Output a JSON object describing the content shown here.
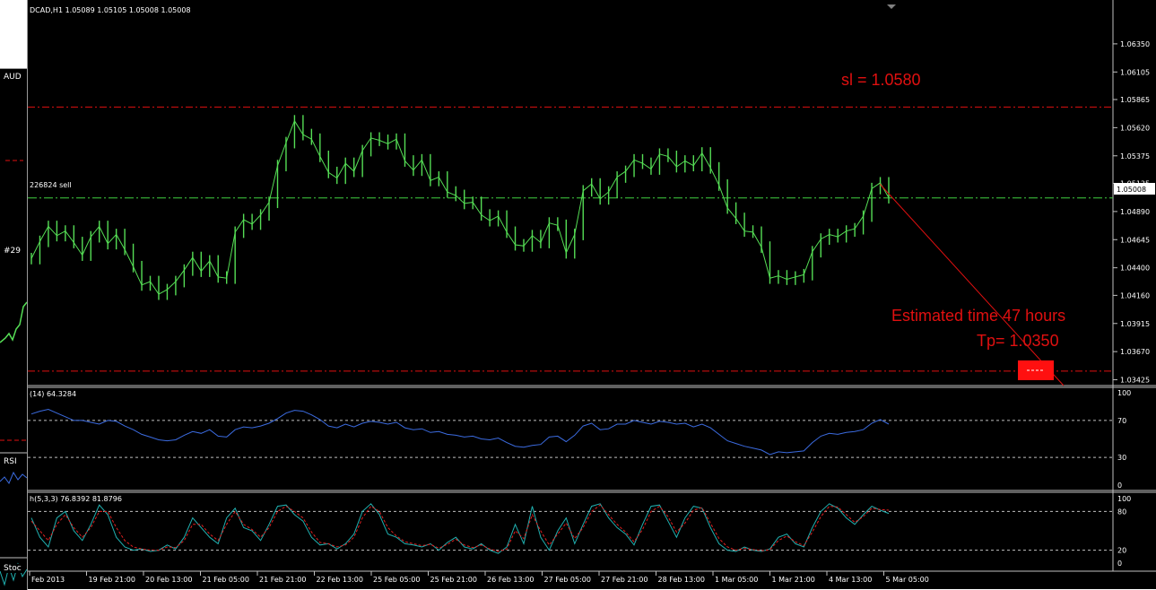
{
  "background_window": {
    "labels": [
      "AUD",
      "#29",
      "RSI",
      "Stoc"
    ]
  },
  "chart_data": {
    "type": "line",
    "symbol_header": "DCAD,H1  1.05089 1.05105 1.05008 1.05008",
    "price_axis_labels": [
      "1.06350",
      "1.06105",
      "1.05865",
      "1.05620",
      "1.05375",
      "1.05135",
      "1.04890",
      "1.04645",
      "1.04400",
      "1.04160",
      "1.03915",
      "1.03670",
      "1.03425"
    ],
    "current_price_label": "1.05008",
    "ylim": [
      1.0339,
      1.0656
    ],
    "time_labels": [
      "Feb 2013",
      "19 Feb 21:00",
      "20 Feb 13:00",
      "21 Feb 05:00",
      "21 Feb 21:00",
      "22 Feb 13:00",
      "25 Feb 05:00",
      "25 Feb 21:00",
      "26 Feb 13:00",
      "27 Feb 05:00",
      "27 Feb 21:00",
      "28 Feb 13:00",
      "1 Mar 05:00",
      "1 Mar 21:00",
      "4 Mar 13:00",
      "5 Mar 05:00"
    ],
    "price_series_close": [
      1.0448,
      1.0463,
      1.0476,
      1.0468,
      1.0472,
      1.0462,
      1.0451,
      1.0467,
      1.0476,
      1.0461,
      1.0469,
      1.0456,
      1.0441,
      1.0425,
      1.0428,
      1.0417,
      1.0421,
      1.0428,
      1.0438,
      1.0449,
      1.0437,
      1.0446,
      1.0432,
      1.0431,
      1.0471,
      1.0482,
      1.0478,
      1.0486,
      1.0497,
      1.0529,
      1.0549,
      1.0568,
      1.0556,
      1.0552,
      1.0537,
      1.0523,
      1.0518,
      1.0531,
      1.0524,
      1.0542,
      1.0553,
      1.0551,
      1.0548,
      1.0552,
      1.0533,
      1.0525,
      1.0534,
      1.0516,
      1.0519,
      1.0506,
      1.0503,
      1.0496,
      1.0497,
      1.0486,
      1.0481,
      1.0485,
      1.0471,
      1.046,
      1.0459,
      1.0468,
      1.0462,
      1.0479,
      1.0477,
      1.0453,
      1.0469,
      1.0507,
      1.0513,
      1.05,
      1.0506,
      1.0519,
      1.0524,
      1.0534,
      1.0531,
      1.0526,
      1.0539,
      1.0537,
      1.0528,
      1.0533,
      1.0529,
      1.054,
      1.0527,
      1.0512,
      1.0492,
      1.0483,
      1.0472,
      1.0471,
      1.0458,
      1.0431,
      1.0433,
      1.043,
      1.0432,
      1.0434,
      1.0454,
      1.0465,
      1.0469,
      1.0467,
      1.0472,
      1.0474,
      1.0485,
      1.0509,
      1.0514,
      1.0501
    ],
    "order_label": "226824 sell",
    "order_price": 1.05008,
    "sl_price": 1.058,
    "tp_price": 1.035,
    "annotations": {
      "sl": "sl = 1.0580",
      "estimated": "Estimated time 47 hours",
      "tp": "Tp= 1.0350"
    },
    "rsi": {
      "label": "(14) 64.3284",
      "levels": [
        30,
        70
      ],
      "axis_labels": [
        "100",
        "70",
        "30",
        "0"
      ],
      "values": [
        77,
        80,
        82,
        78,
        74,
        70,
        70,
        68,
        66,
        70,
        69,
        64,
        60,
        55,
        52,
        49,
        48,
        49,
        54,
        58,
        56,
        60,
        53,
        52,
        60,
        63,
        62,
        64,
        67,
        72,
        78,
        81,
        80,
        76,
        71,
        64,
        62,
        66,
        63,
        67,
        69,
        68,
        66,
        68,
        62,
        60,
        61,
        57,
        58,
        55,
        54,
        52,
        53,
        50,
        49,
        51,
        46,
        42,
        41,
        43,
        44,
        52,
        53,
        47,
        54,
        64,
        67,
        60,
        61,
        66,
        66,
        70,
        68,
        66,
        69,
        68,
        66,
        67,
        63,
        66,
        62,
        55,
        48,
        45,
        42,
        40,
        38,
        33,
        36,
        35,
        36,
        37,
        46,
        53,
        56,
        55,
        57,
        58,
        60,
        67,
        71,
        66
      ]
    },
    "stoch": {
      "label": "h(5,3,3) 76.8392 81.8796",
      "levels": [
        20,
        80
      ],
      "axis_labels": [
        "100",
        "80",
        "20",
        "0"
      ],
      "main": [
        70,
        40,
        25,
        70,
        80,
        50,
        35,
        60,
        90,
        75,
        40,
        25,
        20,
        22,
        18,
        20,
        28,
        22,
        40,
        70,
        55,
        40,
        30,
        70,
        85,
        55,
        50,
        35,
        60,
        88,
        90,
        75,
        65,
        40,
        28,
        30,
        22,
        30,
        45,
        80,
        92,
        75,
        45,
        40,
        30,
        28,
        25,
        30,
        20,
        32,
        40,
        25,
        22,
        30,
        20,
        15,
        25,
        60,
        30,
        88,
        40,
        20,
        50,
        70,
        30,
        60,
        88,
        92,
        70,
        55,
        45,
        28,
        60,
        88,
        90,
        65,
        40,
        70,
        88,
        85,
        55,
        30,
        20,
        18,
        25,
        20,
        18,
        22,
        40,
        45,
        30,
        25,
        55,
        80,
        92,
        85,
        70,
        60,
        75,
        88,
        82,
        77
      ],
      "signal": [
        65,
        50,
        35,
        60,
        75,
        55,
        40,
        55,
        80,
        80,
        55,
        35,
        25,
        22,
        20,
        20,
        25,
        24,
        35,
        60,
        60,
        45,
        35,
        60,
        80,
        60,
        52,
        40,
        55,
        80,
        88,
        80,
        70,
        48,
        32,
        30,
        25,
        28,
        40,
        70,
        88,
        80,
        55,
        42,
        33,
        30,
        27,
        29,
        23,
        29,
        37,
        28,
        24,
        28,
        22,
        18,
        22,
        50,
        38,
        75,
        50,
        28,
        45,
        62,
        38,
        55,
        80,
        90,
        75,
        60,
        48,
        33,
        52,
        80,
        88,
        72,
        48,
        62,
        82,
        86,
        62,
        38,
        25,
        20,
        23,
        21,
        19,
        21,
        35,
        42,
        33,
        27,
        48,
        72,
        88,
        87,
        75,
        63,
        72,
        85,
        83,
        82
      ]
    }
  },
  "colors": {
    "background": "#000000",
    "candle": "#55dd55",
    "grid_line": "#c0c0c0",
    "rsi_line": "#3b6be0",
    "stoch_main": "#20b0b0",
    "stoch_signal": "#e02020",
    "annotation_red": "#e01010",
    "order_line": "#40d040"
  }
}
